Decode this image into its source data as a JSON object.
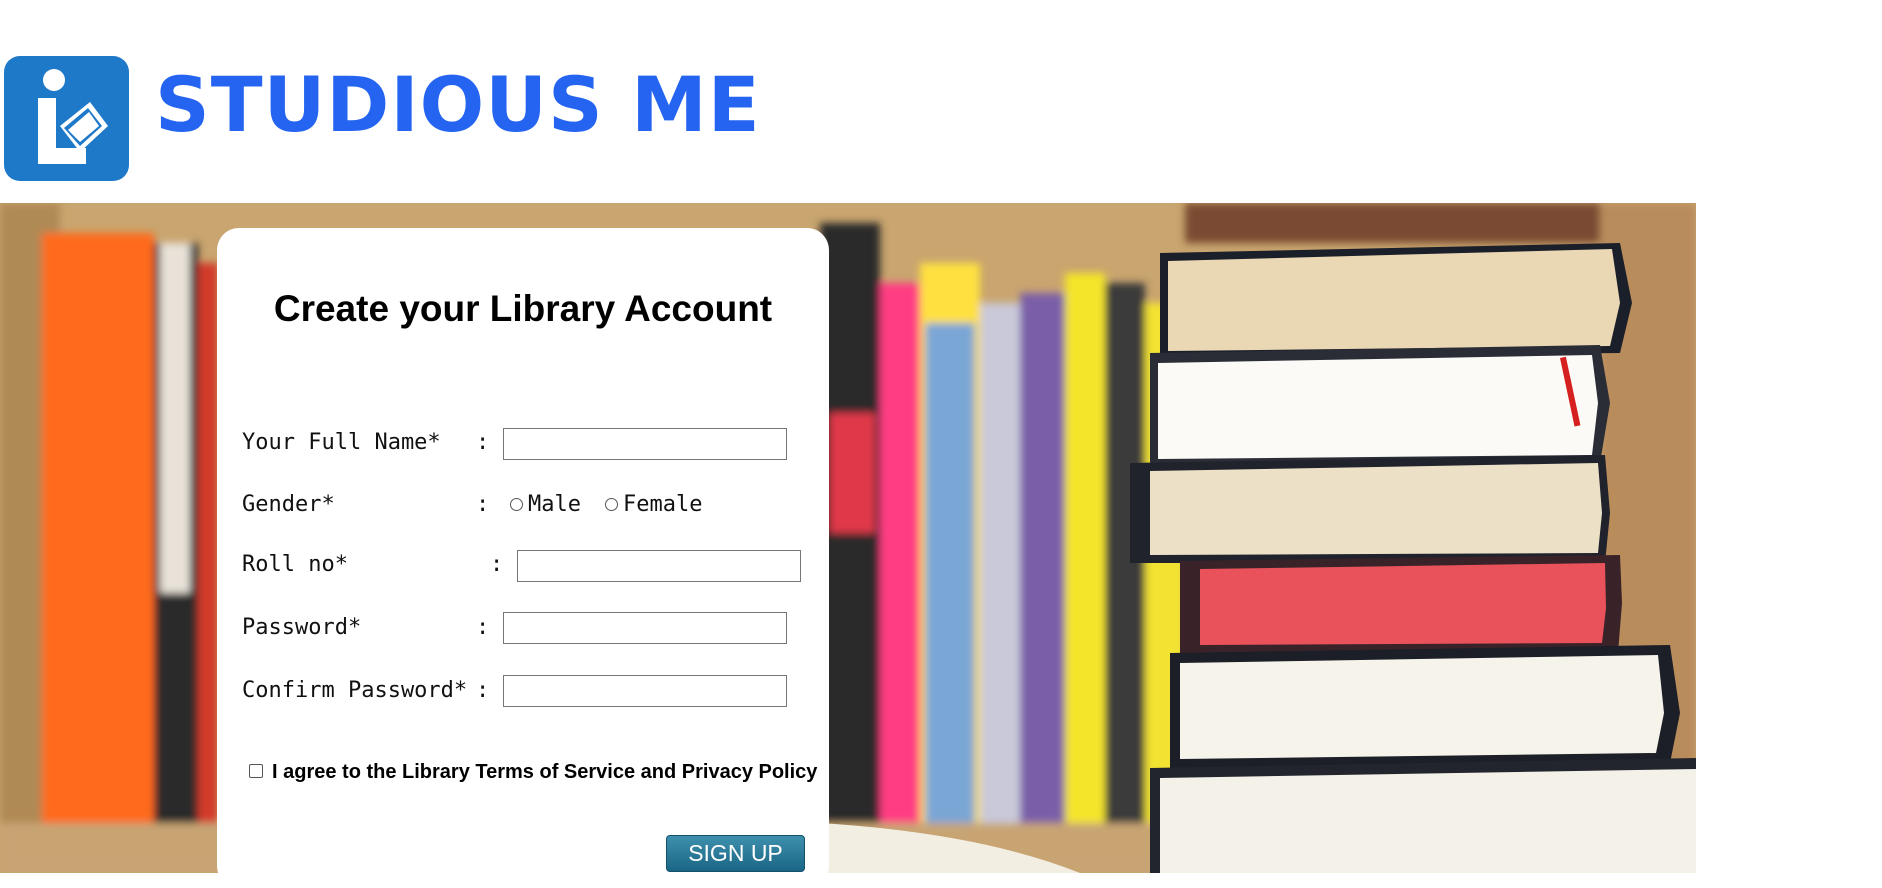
{
  "header": {
    "brand_name": "STUDIOUS ME",
    "logo_icon": "library-reader-icon"
  },
  "form": {
    "title": "Create your Library Account",
    "fields": {
      "full_name": {
        "label": "Your Full Name*",
        "value": ""
      },
      "gender": {
        "label": "Gender*",
        "options": [
          "Male",
          "Female"
        ]
      },
      "roll_no": {
        "label": "Roll no*",
        "value": ""
      },
      "password": {
        "label": "Password*",
        "value": ""
      },
      "confirm_password": {
        "label": "Confirm Password*",
        "value": ""
      }
    },
    "separator": ":",
    "agree_label": "I agree to the Library Terms of Service and Privacy Policy",
    "submit_label": "SIGN UP"
  },
  "colors": {
    "brand": "#2464f0",
    "logo_bg": "#1f79c9",
    "button": "#1a6585"
  }
}
